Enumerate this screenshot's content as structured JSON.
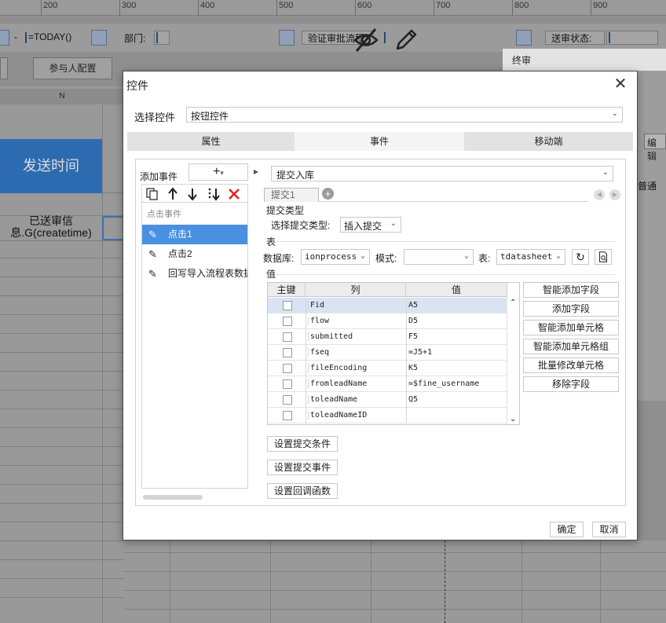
{
  "ruler": {
    "ticks": [
      "200",
      "300",
      "400",
      "500",
      "600",
      "700",
      "800",
      "900"
    ]
  },
  "param_bar": {
    "dash": "-",
    "today_value": "=TODAY()",
    "dept_label": "部门:",
    "verify_label": "验证审批流程",
    "send_status_label": "送审状态:"
  },
  "bg": {
    "participants_button": "参与人配置",
    "final_review": "终审",
    "edit_button": "编辑",
    "normal_text": "普通",
    "column_header": "N",
    "send_time_header": "发送时间",
    "cell_expression": "已送审信息.G(createtime)"
  },
  "dialog": {
    "title": "控件",
    "close_symbol": "✕",
    "select_control_label": "选择控件",
    "select_control_value": "按钮控件",
    "tabs": [
      "属性",
      "事件",
      "移动端"
    ],
    "active_tab": "事件",
    "add_event_label": "添加事件",
    "add_event_symbol": "+",
    "add_event_chevron": "▾",
    "event_group": "点击事件",
    "events": [
      "点击1",
      "点击2",
      "回写导入流程表数据"
    ],
    "selected_event": "点击1",
    "submit_type_select": "提交入库",
    "sub_tab": "提交1",
    "sections": {
      "submit_type": "提交类型",
      "table": "表",
      "value": "值"
    },
    "submit_type_label": "选择提交类型:",
    "submit_type_value": "插入提交",
    "db_label": "数据库:",
    "db_value": "ionprocess",
    "schema_label": "模式:",
    "schema_value": "",
    "table_label": "表:",
    "table_value": "tdatasheet",
    "grid_headers": [
      "主键",
      "列",
      "值"
    ],
    "grid_rows": [
      {
        "column": "Fid",
        "value": "A5"
      },
      {
        "column": "flow",
        "value": "D5"
      },
      {
        "column": "submitted",
        "value": "F5"
      },
      {
        "column": "fseq",
        "value": "=J5+1"
      },
      {
        "column": "fileEncoding",
        "value": "K5"
      },
      {
        "column": "fromleadName",
        "value": "=$fine_username"
      },
      {
        "column": "toleadName",
        "value": "Q5"
      },
      {
        "column": "toleadNameID",
        "value": ""
      }
    ],
    "action_buttons": [
      "智能添加字段",
      "添加字段",
      "智能添加单元格",
      "智能添加单元格组",
      "批量修改单元格",
      "移除字段"
    ],
    "bottom_buttons": [
      "设置提交条件",
      "设置提交事件",
      "设置回调函数"
    ],
    "ok": "确定",
    "cancel": "取消"
  },
  "icons": {
    "copy": "copy-icon",
    "up": "arrow-up-icon",
    "down": "arrow-down-icon",
    "move_bottom": "move-to-bottom-icon",
    "delete": "delete-icon",
    "refresh": "refresh-icon",
    "preview": "preview-icon"
  },
  "colors": {
    "accent_blue": "#4a90e2",
    "delete_red": "#e02020",
    "header_blue": "#2d6bb0"
  }
}
